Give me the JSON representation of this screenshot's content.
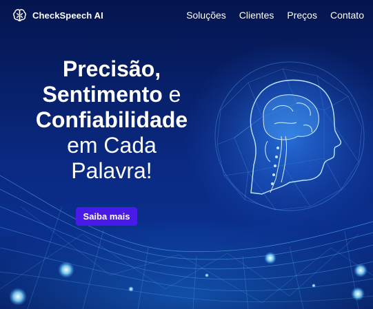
{
  "header": {
    "brand": "CheckSpeech AI",
    "nav": [
      "Soluções",
      "Clientes",
      "Preços",
      "Contato"
    ]
  },
  "hero": {
    "heading_parts": [
      {
        "text": "Precisão,",
        "bold": true
      },
      {
        "text": "Sentimento",
        "bold": true
      },
      {
        "text": " e",
        "bold": false
      },
      {
        "text": "Confiabilidade",
        "bold": true
      },
      {
        "text": "em Cada",
        "bold": false
      },
      {
        "text": "Palavra!",
        "bold": false
      }
    ],
    "cta_label": "Saiba mais"
  },
  "icons": {
    "logo": "brain-icon",
    "illustration": "digital-head-brain-illustration"
  },
  "colors": {
    "background": "#0a2a84",
    "cta": "#4a1be8",
    "glow": "#6fd3ff"
  }
}
